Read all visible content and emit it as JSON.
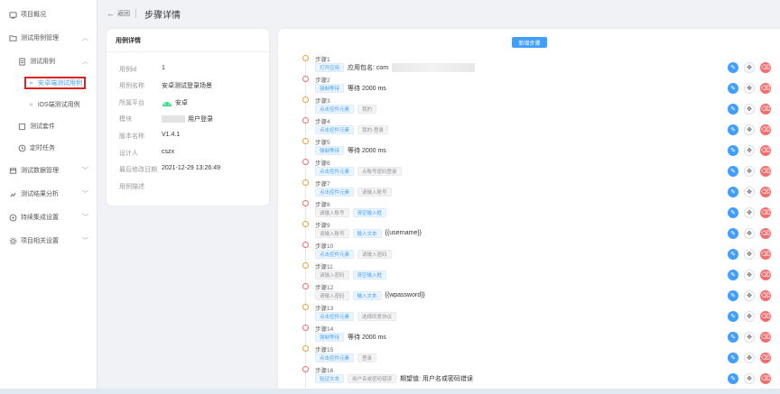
{
  "sidebar": {
    "items": [
      {
        "label": "项目概况",
        "icon": "dashboard-icon",
        "arrow": ""
      },
      {
        "label": "测试用例管理",
        "icon": "folder-icon",
        "arrow": "^"
      },
      {
        "label": "测试用例",
        "icon": "file-icon",
        "arrow": "^"
      },
      {
        "label": "安卓端测试用例",
        "icon": "double-chevron-icon",
        "arrow": ""
      },
      {
        "label": "iOS端测试用例",
        "icon": "double-chevron-icon",
        "arrow": ""
      },
      {
        "label": "测试套件",
        "icon": "suite-icon",
        "arrow": ""
      },
      {
        "label": "定时任务",
        "icon": "clock-icon",
        "arrow": ""
      },
      {
        "label": "测试数据管理",
        "icon": "database-icon",
        "arrow": "v"
      },
      {
        "label": "测试结果分析",
        "icon": "chart-icon",
        "arrow": "v"
      },
      {
        "label": "持续集成设置",
        "icon": "ci-icon",
        "arrow": "v"
      },
      {
        "label": "项目相关设置",
        "icon": "settings-icon",
        "arrow": "v"
      }
    ]
  },
  "header": {
    "back_label": "返回",
    "title": "步骤详情"
  },
  "detail": {
    "title": "用例详情",
    "rows": [
      {
        "key": "用例id",
        "value": "1"
      },
      {
        "key": "用例名称",
        "value": "安卓测试登录场景"
      },
      {
        "key": "所属平台",
        "value": "安卓"
      },
      {
        "key": "模块",
        "value": "用户登录"
      },
      {
        "key": "版本名称",
        "value": "V1.4.1"
      },
      {
        "key": "设计人",
        "value": "cszx"
      },
      {
        "key": "最后修改日期",
        "value": "2021-12-29 13:26:49"
      },
      {
        "key": "用例描述",
        "value": ""
      }
    ]
  },
  "steps_panel": {
    "new_step_label": "新增步骤",
    "steps": [
      {
        "name": "步骤1",
        "tags": [
          {
            "text": "打开应用",
            "style": "blue"
          }
        ],
        "text": "应用包名: com",
        "blurred": true
      },
      {
        "name": "步骤2",
        "tags": [
          {
            "text": "强制等待",
            "style": "blue"
          }
        ],
        "text": "等待 2000 ms"
      },
      {
        "name": "步骤3",
        "tags": [
          {
            "text": "点击控件元素",
            "style": "blue"
          },
          {
            "text": "我的",
            "style": "gray"
          }
        ],
        "text": ""
      },
      {
        "name": "步骤4",
        "tags": [
          {
            "text": "点击控件元素",
            "style": "blue"
          },
          {
            "text": "我的-登录",
            "style": "gray"
          }
        ],
        "text": ""
      },
      {
        "name": "步骤5",
        "tags": [
          {
            "text": "强制等待",
            "style": "blue"
          }
        ],
        "text": "等待 2000 ms"
      },
      {
        "name": "步骤6",
        "tags": [
          {
            "text": "点击控件元素",
            "style": "blue"
          },
          {
            "text": "点账号密码登录",
            "style": "gray"
          }
        ],
        "text": ""
      },
      {
        "name": "步骤7",
        "tags": [
          {
            "text": "点击控件元素",
            "style": "blue"
          },
          {
            "text": "请输入账号",
            "style": "gray"
          }
        ],
        "text": ""
      },
      {
        "name": "步骤8",
        "tags": [
          {
            "text": "请输入账号",
            "style": "gray"
          },
          {
            "text": "清空输入框",
            "style": "blue"
          }
        ],
        "text": ""
      },
      {
        "name": "步骤9",
        "tags": [
          {
            "text": "请输入账号",
            "style": "gray"
          },
          {
            "text": "输入文本",
            "style": "blue"
          }
        ],
        "text": "{{username}}"
      },
      {
        "name": "步骤10",
        "tags": [
          {
            "text": "点击控件元素",
            "style": "blue"
          },
          {
            "text": "请输入密码",
            "style": "gray"
          }
        ],
        "text": ""
      },
      {
        "name": "步骤11",
        "tags": [
          {
            "text": "请输入密码",
            "style": "gray"
          },
          {
            "text": "清空输入框",
            "style": "blue"
          }
        ],
        "text": ""
      },
      {
        "name": "步骤12",
        "tags": [
          {
            "text": "请输入密码",
            "style": "gray"
          },
          {
            "text": "输入文本",
            "style": "blue"
          }
        ],
        "text": "{{wpassword}}"
      },
      {
        "name": "步骤13",
        "tags": [
          {
            "text": "点击控件元素",
            "style": "blue"
          },
          {
            "text": "选择同意协议",
            "style": "gray"
          }
        ],
        "text": ""
      },
      {
        "name": "步骤14",
        "tags": [
          {
            "text": "强制等待",
            "style": "blue"
          }
        ],
        "text": "等待 2000 ms"
      },
      {
        "name": "步骤15",
        "tags": [
          {
            "text": "点击控件元素",
            "style": "blue"
          },
          {
            "text": "登录",
            "style": "gray"
          }
        ],
        "text": ""
      },
      {
        "name": "步骤16",
        "tags": [
          {
            "text": "验证文本",
            "style": "blue"
          },
          {
            "text": "用户名或密码错误",
            "style": "gray"
          }
        ],
        "text": "期望值: 用户名或密码错误"
      }
    ]
  },
  "colors": {
    "accent": "#409eff",
    "danger": "#f56c6c",
    "warning": "#e6a23c",
    "highlight_box": "#e02020"
  }
}
